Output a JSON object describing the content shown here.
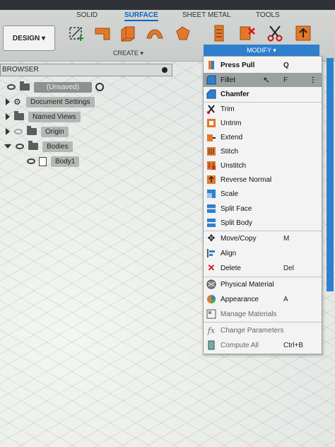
{
  "tabs": [
    "SOLID",
    "SURFACE",
    "SHEET METAL",
    "TOOLS"
  ],
  "active_tab": "SURFACE",
  "workspace": "DESIGN ▾",
  "groups": {
    "create": "CREATE ▾",
    "modify": "MODIFY ▾"
  },
  "browser": {
    "title": "BROWSER",
    "items": [
      "(Unsaved)",
      "Document Settings",
      "Named Views",
      "Origin",
      "Bodies",
      "Body1"
    ]
  },
  "menu": {
    "items": [
      {
        "label": "Press Pull",
        "shortcut": "Q"
      },
      {
        "label": "Fillet",
        "shortcut": "F"
      },
      {
        "label": "Chamfer",
        "shortcut": ""
      },
      {
        "label": "Trim",
        "shortcut": ""
      },
      {
        "label": "Untrim",
        "shortcut": ""
      },
      {
        "label": "Extend",
        "shortcut": ""
      },
      {
        "label": "Stitch",
        "shortcut": ""
      },
      {
        "label": "Unstitch",
        "shortcut": ""
      },
      {
        "label": "Reverse Normal",
        "shortcut": ""
      },
      {
        "label": "Scale",
        "shortcut": ""
      },
      {
        "label": "Split Face",
        "shortcut": ""
      },
      {
        "label": "Split Body",
        "shortcut": ""
      },
      {
        "label": "Move/Copy",
        "shortcut": "M"
      },
      {
        "label": "Align",
        "shortcut": ""
      },
      {
        "label": "Delete",
        "shortcut": "Del"
      },
      {
        "label": "Physical Material",
        "shortcut": ""
      },
      {
        "label": "Appearance",
        "shortcut": "A"
      },
      {
        "label": "Manage Materials",
        "shortcut": ""
      },
      {
        "label": "Change Parameters",
        "shortcut": ""
      },
      {
        "label": "Compute All",
        "shortcut": "Ctrl+B"
      }
    ]
  },
  "colors": {
    "accent": "#2f7fcf",
    "orange": "#e4782a",
    "highlight": "#9ba0a0"
  }
}
